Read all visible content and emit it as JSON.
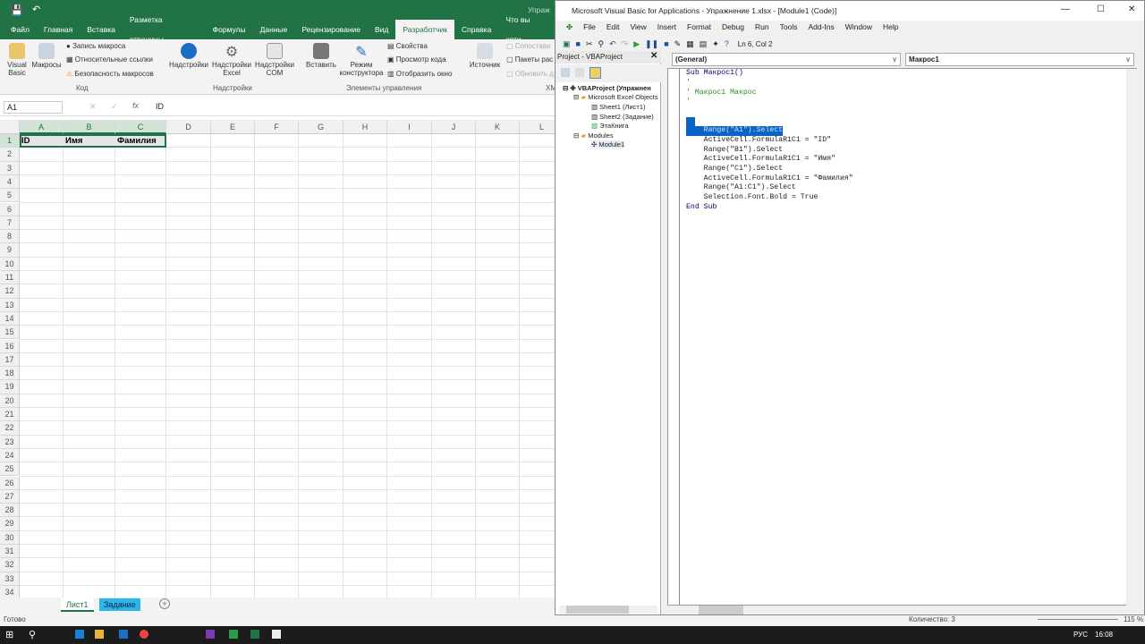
{
  "excel": {
    "doc_title": "Упраж",
    "tabs": [
      "Файл",
      "Главная",
      "Вставка",
      "Разметка страницы",
      "Формулы",
      "Данные",
      "Рецензирование",
      "Вид",
      "Разработчик",
      "Справка",
      "Что вы хоти"
    ],
    "active_tab": "Разработчик",
    "ribbon": {
      "visual_basic": "Visual Basic",
      "macros": "Макросы",
      "record_macro": "Запись макроса",
      "relative_refs": "Относительные ссылки",
      "macro_security": "Безопасность макросов",
      "group_code": "Код",
      "addins": "Надстройки",
      "excel_addins": "Надстройки Excel",
      "com_addins": "Надстройки COM",
      "group_addins": "Надстройки",
      "insert": "Вставить",
      "design_mode": "Режим конструктора",
      "properties": "Свойства",
      "view_code": "Просмотр кода",
      "run_dialog": "Отобразить окно",
      "group_controls": "Элементы управления",
      "source": "Источник",
      "map_props": "Сопостави",
      "expansion_packs": "Пакеты рас",
      "refresh_data": "Обновить д",
      "group_xml": "XM"
    },
    "name_box": "A1",
    "formula": "ID",
    "columns": [
      "A",
      "B",
      "C",
      "D",
      "E",
      "F",
      "G",
      "H",
      "I",
      "J",
      "K",
      "L"
    ],
    "rows": [
      "1",
      "2",
      "3",
      "4",
      "5",
      "6",
      "7",
      "8",
      "9",
      "10",
      "11",
      "12",
      "13",
      "14",
      "15",
      "16",
      "17",
      "18",
      "19",
      "20",
      "21",
      "22",
      "23",
      "24",
      "25",
      "26",
      "27",
      "28",
      "29",
      "30",
      "31",
      "32",
      "33",
      "34"
    ],
    "cells": {
      "A1": "ID",
      "B1": "Имя",
      "C1": "Фамилия"
    },
    "sheets": [
      "Лист1",
      "Задание"
    ],
    "status_ready": "Готово",
    "status_count": "Количество: 3",
    "zoom": "115 %"
  },
  "vba": {
    "title": "Microsoft Visual Basic for Applications - Упражнение 1.xlsx - [Module1 (Code)]",
    "menu": [
      "File",
      "Edit",
      "View",
      "Insert",
      "Format",
      "Debug",
      "Run",
      "Tools",
      "Add-Ins",
      "Window",
      "Help"
    ],
    "cursor_pos": "Ln 6, Col 2",
    "project_title": "Project - VBAProject",
    "tree": [
      "VBAProject (Упражнен",
      "Microsoft Excel Objects",
      "Sheet1 (Лист1)",
      "Sheet2 (Задание)",
      "ЭтаКнига",
      "Modules",
      "Module1"
    ],
    "object_dropdown": "(General)",
    "proc_dropdown": "Макрос1",
    "code": [
      "Sub Макрос1()",
      "'",
      "' Макрос1 Макрос",
      "'",
      "",
      "'",
      "    Range(\"A1\").Select",
      "    ActiveCell.FormulaR1C1 = \"ID\"",
      "    Range(\"B1\").Select",
      "    ActiveCell.FormulaR1C1 = \"Имя\"",
      "    Range(\"C1\").Select",
      "    ActiveCell.FormulaR1C1 = \"Фамилия\"",
      "    Range(\"A1:C1\").Select",
      "    Selection.Font.Bold = True",
      "End Sub"
    ]
  },
  "taskbar": {
    "lang": "РУС",
    "time": "16:08"
  },
  "colors": {
    "excel_green": "#217346",
    "selection": "#0a64c8",
    "comment": "#2e8b22",
    "sheet_active_tab": "#29b6e8"
  }
}
